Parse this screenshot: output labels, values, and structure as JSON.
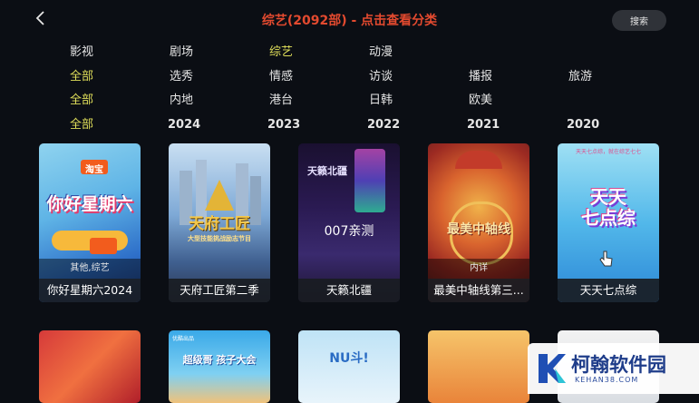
{
  "header": {
    "title": "综艺(2092部) - 点击查看分类",
    "search_label": "搜索"
  },
  "filters": {
    "type": [
      "影视",
      "剧场",
      "综艺",
      "动漫"
    ],
    "genre": [
      "全部",
      "选秀",
      "情感",
      "访谈",
      "播报",
      "旅游"
    ],
    "region": [
      "全部",
      "内地",
      "港台",
      "日韩",
      "欧美"
    ],
    "year": [
      "全部",
      "2024",
      "2023",
      "2022",
      "2021",
      "2020"
    ],
    "active": {
      "type": "综艺",
      "genre": "全部",
      "region": "全部",
      "year": "全部"
    }
  },
  "cards": [
    {
      "title": "你好星期六2024",
      "tag": "其他,综艺",
      "poster_text": "你好星期六",
      "poster_sub": "淘宝"
    },
    {
      "title": "天府工匠第二季",
      "tag": "",
      "poster_text": "天府工匠",
      "poster_sub": "大型技能挑战励志节目"
    },
    {
      "title": "天籁北疆",
      "tag": "",
      "poster_text": "007亲测",
      "poster_sub": "天籁北疆"
    },
    {
      "title": "最美中轴线第三...",
      "tag": "内详",
      "poster_text": "最美中轴线",
      "poster_sub": ""
    },
    {
      "title": "天天七点综",
      "tag": "",
      "poster_text": "天天\n七点综",
      "poster_sub": "天天七点综，就在综艺七七"
    }
  ],
  "row2_cards": [
    {
      "poster_text": ""
    },
    {
      "poster_text": "超级哥 孩子大会",
      "poster_sub": "优酷出品"
    },
    {
      "poster_text": "NU斗!",
      "poster_sub": ""
    },
    {
      "poster_text": "",
      "poster_sub": ""
    },
    {
      "poster_text": "",
      "poster_sub": ""
    }
  ],
  "watermark": {
    "name": "柯翰软件园",
    "url": "KEHAN38.COM"
  },
  "colors": {
    "title": "#e34a2f",
    "active_filter": "#e0df5a",
    "background": "#0b0e14"
  }
}
